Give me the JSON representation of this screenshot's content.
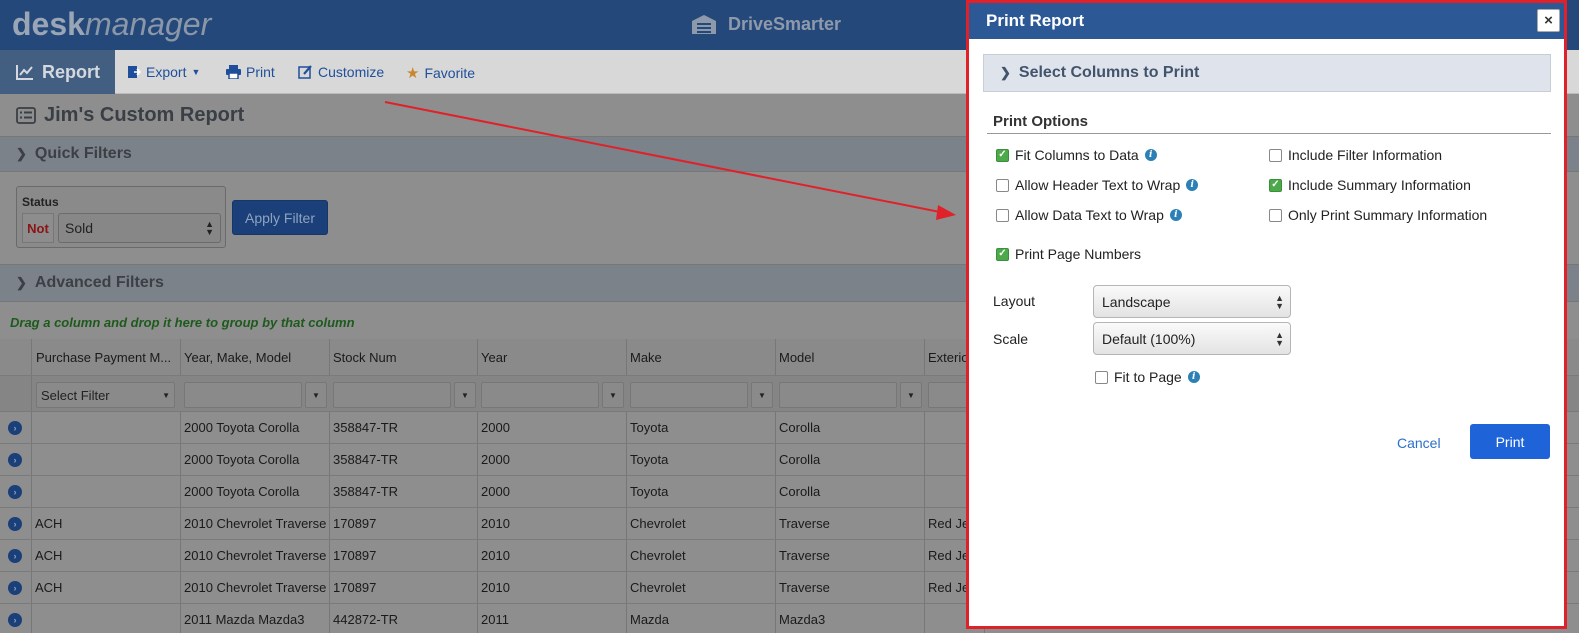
{
  "app": {
    "logo_strong": "desk",
    "logo_rest": "manager",
    "brand": "DriveSmarter"
  },
  "toolbar": {
    "report": "Report",
    "export": "Export",
    "print": "Print",
    "customize": "Customize",
    "favorite": "Favorite"
  },
  "page": {
    "title": "Jim's Custom Report",
    "quick_filters": "Quick Filters",
    "advanced_filters": "Advanced Filters",
    "drag_note": "Drag a column and drop it here to group by that column"
  },
  "status_filter": {
    "label": "Status",
    "not": "Not",
    "value": "Sold",
    "apply": "Apply Filter"
  },
  "grid": {
    "columns": [
      "Purchase Payment M...",
      "Year, Make, Model",
      "Stock Num",
      "Year",
      "Make",
      "Model",
      "Exterio"
    ],
    "first_filter": "Select Filter",
    "rows": [
      [
        "",
        "2000 Toyota Corolla",
        "358847-TR",
        "2000",
        "Toyota",
        "Corolla",
        ""
      ],
      [
        "",
        "2000 Toyota Corolla",
        "358847-TR",
        "2000",
        "Toyota",
        "Corolla",
        ""
      ],
      [
        "",
        "2000 Toyota Corolla",
        "358847-TR",
        "2000",
        "Toyota",
        "Corolla",
        ""
      ],
      [
        "ACH",
        "2010 Chevrolet Traverse",
        "170897",
        "2010",
        "Chevrolet",
        "Traverse",
        "Red Je"
      ],
      [
        "ACH",
        "2010 Chevrolet Traverse",
        "170897",
        "2010",
        "Chevrolet",
        "Traverse",
        "Red Je"
      ],
      [
        "ACH",
        "2010 Chevrolet Traverse",
        "170897",
        "2010",
        "Chevrolet",
        "Traverse",
        "Red Je"
      ],
      [
        "",
        "2011 Mazda Mazda3",
        "442872-TR",
        "2011",
        "Mazda",
        "Mazda3",
        ""
      ]
    ]
  },
  "modal": {
    "title": "Print Report",
    "close": "×",
    "select_columns": "Select Columns to Print",
    "print_options": "Print Options",
    "options": {
      "fit_columns": {
        "label": "Fit Columns to Data",
        "checked": true
      },
      "header_wrap": {
        "label": "Allow Header Text to Wrap",
        "checked": false
      },
      "data_wrap": {
        "label": "Allow Data Text to Wrap",
        "checked": false
      },
      "filter_info": {
        "label": "Include Filter Information",
        "checked": false
      },
      "summary_info": {
        "label": "Include Summary Information",
        "checked": true
      },
      "only_summary": {
        "label": "Only Print Summary Information",
        "checked": false
      },
      "page_numbers": {
        "label": "Print Page Numbers",
        "checked": true
      },
      "fit_to_page": {
        "label": "Fit to Page",
        "checked": false
      }
    },
    "layout_label": "Layout",
    "layout_value": "Landscape",
    "scale_label": "Scale",
    "scale_value": "Default (100%)",
    "cancel": "Cancel",
    "print": "Print"
  },
  "colors": {
    "header_blue": "#2d5896",
    "primary_button": "#1f63d8",
    "check_green": "#4caa4a",
    "highlight_red": "#e0212a"
  }
}
